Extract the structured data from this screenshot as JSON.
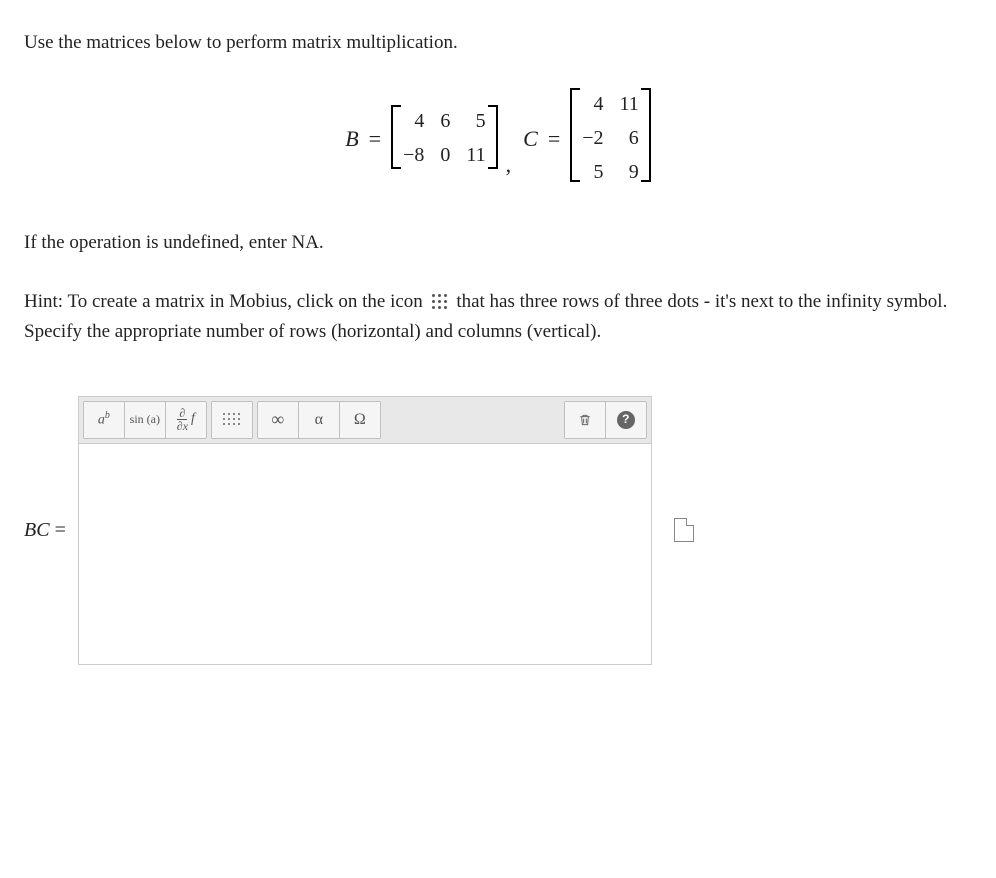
{
  "prompt": "Use the matrices below to perform matrix multiplication.",
  "note": "If the operation is undefined, enter NA.",
  "hint_prefix": "Hint: To create a matrix in Mobius, click on the icon ",
  "hint_suffix": " that has three rows of three dots - it's next to the infinity symbol. Specify the appropriate number of rows (horizontal) and columns (vertical).",
  "answer_label": "BC =",
  "matrices": {
    "B": {
      "name": "B",
      "rows": 2,
      "cols": 3,
      "data": [
        [
          4,
          6,
          5
        ],
        [
          -8,
          0,
          11
        ]
      ]
    },
    "C": {
      "name": "C",
      "rows": 3,
      "cols": 2,
      "data": [
        [
          4,
          11
        ],
        [
          -2,
          6
        ],
        [
          5,
          9
        ]
      ]
    }
  },
  "toolbar": {
    "exponent": "a",
    "exponent_sup": "b",
    "trig": "sin (a)",
    "deriv_top": "∂",
    "deriv_bot": "∂x",
    "deriv_f": "f",
    "infinity": "∞",
    "alpha_lower": "α",
    "omega_upper": "Ω",
    "help": "?"
  }
}
